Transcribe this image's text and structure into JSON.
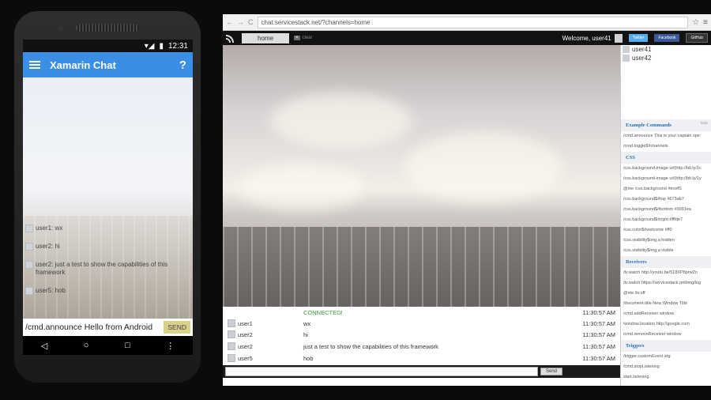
{
  "phone": {
    "status_time": "12:31",
    "app_title": "Xamarin Chat",
    "help_label": "?",
    "messages": [
      "user1: wx",
      "user2: hi",
      "user2: just a test to show the capabilities of this framework",
      "user5: hob"
    ],
    "input_value": "/cmd.announce Hello from Android",
    "send_label": "SEND",
    "nav_back": "◁",
    "nav_home": "○",
    "nav_recent": "□",
    "nav_more": "⋮"
  },
  "browser": {
    "url": "chat.servicestack.net/?channels=home",
    "tab_home": "home",
    "clear_label": "clear",
    "welcome": "Welcome, user41",
    "twitter": "Twitter",
    "facebook": "Facebook",
    "github": "GitHub",
    "send_label": "Send",
    "log": [
      {
        "user": "",
        "msg": "CONNECTED!",
        "time": "11:30:57 AM"
      },
      {
        "user": "user1",
        "msg": "wx",
        "time": "11:30:57 AM"
      },
      {
        "user": "user2",
        "msg": "hi",
        "time": "11:30:57 AM"
      },
      {
        "user": "user2",
        "msg": "just a test to show the capabilities of this framework",
        "time": "11:30:57 AM"
      },
      {
        "user": "user5",
        "msg": "hob",
        "time": "11:30:57 AM"
      }
    ],
    "users": [
      "user41",
      "user42"
    ],
    "sidebar": {
      "example_title": "Example Commands",
      "hide_label": "hide",
      "example_cmds": [
        "/cmd.announce This is your captain spe",
        "/cmd.toggle$#channels"
      ],
      "css_title": "CSS",
      "css_cmds": [
        "/css.background-image url(http://bit.ly/1c",
        "/css.background-image url(http://bit.ly/1y",
        "@me /css.background #eceff1",
        "/css.background$#top #673ab7",
        "/css.background$#bottom #0091ea",
        "/css.background$#right #fffde7",
        "/css.color$#welcome #ff0",
        "/css.visibility$img,a hidden",
        "/css.visibility$img,a visible"
      ],
      "receivers_title": "Receivers",
      "receiver_cmds": [
        "/tv.watch http://youtu.be/518XP8prwZo",
        "/tv.watch https://servicestack.net/img/log",
        "@me /tv.off",
        "/document.title New Window Title",
        "/cmd.addReceiver window",
        "/window.location http://google.com",
        "/cmd.removeReceiver window"
      ],
      "triggers_title": "Triggers",
      "trigger_cmds": [
        "/trigger.customEvent arg",
        "/cmd.stopListening",
        "start.listening"
      ]
    }
  }
}
